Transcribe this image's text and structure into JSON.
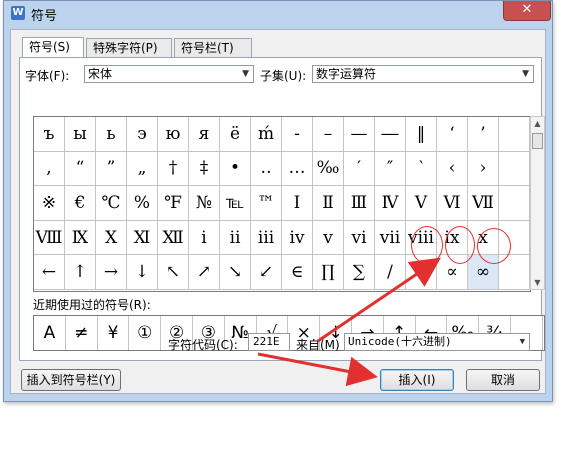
{
  "window": {
    "title": "符号",
    "app_icon_letter": "W",
    "close_glyph": "✕"
  },
  "tabs": [
    {
      "label": "符号(S)"
    },
    {
      "label": "特殊字符(P)"
    },
    {
      "label": "符号栏(T)"
    }
  ],
  "font_row": {
    "font_label": "字体(F):",
    "font_value": "宋体",
    "subset_label": "子集(U):",
    "subset_value": "数字运算符"
  },
  "symbols": [
    [
      "ъ",
      "ы",
      "ь",
      "э",
      "ю",
      "я",
      "ё",
      "ḿ",
      "-",
      "–",
      "—",
      "―",
      "‖",
      "‘",
      "’",
      ""
    ],
    [
      ",",
      "“",
      "”",
      "„",
      "†",
      "‡",
      "•",
      "‥",
      "…",
      "‰",
      "′",
      "″",
      "‵",
      "‹",
      "›",
      ""
    ],
    [
      "※",
      "€",
      "℃",
      "%",
      "℉",
      "№",
      "℡",
      "™",
      "Ⅰ",
      "Ⅱ",
      "Ⅲ",
      "Ⅳ",
      "Ⅴ",
      "Ⅵ",
      "Ⅶ",
      ""
    ],
    [
      "Ⅷ",
      "Ⅸ",
      "Ⅹ",
      "Ⅺ",
      "Ⅻ",
      "ⅰ",
      "ⅱ",
      "ⅲ",
      "ⅳ",
      "ⅴ",
      "ⅵ",
      "ⅶ",
      "ⅷ",
      "ⅸ",
      "ⅹ",
      ""
    ],
    [
      "←",
      "↑",
      "→",
      "↓",
      "↖",
      "↗",
      "↘",
      "↙",
      "∈",
      "∏",
      "∑",
      "∕",
      "√",
      "∝",
      "∞",
      ""
    ]
  ],
  "recent": {
    "label": "近期使用过的符号(R):",
    "items": [
      "A",
      "≠",
      "¥",
      "①",
      "②",
      "③",
      "№",
      "√",
      "×",
      "↓",
      "→",
      "↑",
      "←",
      "‰",
      "¾",
      ""
    ]
  },
  "code_row": {
    "code_label": "字符代码(C):",
    "code_value": "221E",
    "from_label": "来自(M)",
    "from_value": "Unicode(十六进制)"
  },
  "buttons": {
    "insert_to_bar": "插入到符号栏(Y)",
    "insert": "插入(I)",
    "cancel": "取消"
  },
  "colors": {
    "frame": "#bcd3ee",
    "annotation_red": "#e23030",
    "selected_cell": "#dce7f7"
  }
}
